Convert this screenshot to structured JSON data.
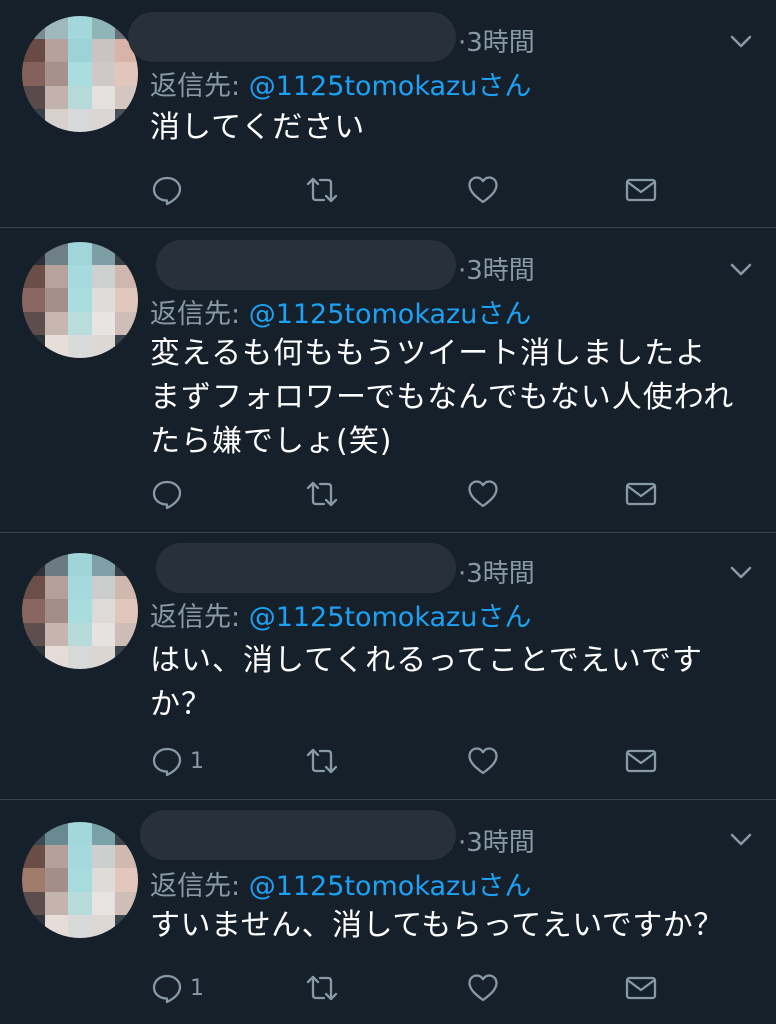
{
  "tweets": [
    {
      "time": "3時間",
      "reply_label": "返信先: ",
      "reply_handle": "@1125tomokazuさん",
      "text": "消してください",
      "reply_count": ""
    },
    {
      "time": "3時間",
      "reply_label": "返信先: ",
      "reply_handle": "@1125tomokazuさん",
      "text": "変えるも何ももうツイート消しましたよ\nまずフォロワーでもなんでもない人使われたら嫌でしょ(笑)",
      "reply_count": ""
    },
    {
      "time": "3時間",
      "reply_label": "返信先: ",
      "reply_handle": "@1125tomokazuさん",
      "text": "はい、消してくれるってことでえいですか？",
      "reply_count": "1"
    },
    {
      "time": "3時間",
      "reply_label": "返信先: ",
      "reply_handle": "@1125tomokazuさん",
      "text": "すいません、消してもらってえいですか？",
      "reply_count": "1"
    }
  ],
  "icons": {
    "reply": "reply-icon",
    "retweet": "retweet-icon",
    "like": "heart-icon",
    "dm": "mail-icon",
    "more": "chevron-down-icon"
  },
  "colors": {
    "background": "#15202b",
    "secondary_text": "#8899a6",
    "link": "#1da1f2",
    "divider": "#38444d"
  }
}
